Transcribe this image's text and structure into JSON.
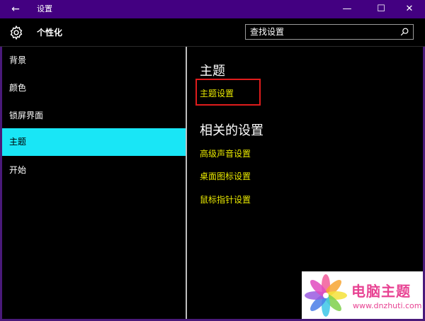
{
  "window": {
    "title": "设置",
    "back_glyph": "←",
    "minimize_glyph": "—",
    "maximize_glyph": "☐",
    "close_glyph": "✕"
  },
  "header": {
    "app_title": "个性化",
    "search_placeholder": "查找设置"
  },
  "sidebar": {
    "items": [
      {
        "label": "背景"
      },
      {
        "label": "颜色"
      },
      {
        "label": "锁屏界面"
      },
      {
        "label": "主题",
        "selected": true
      },
      {
        "label": "开始"
      }
    ]
  },
  "main": {
    "theme_heading": "主题",
    "theme_settings_link": "主题设置",
    "related_heading": "相关的设置",
    "related_links": [
      {
        "label": "高级声音设置"
      },
      {
        "label": "桌面图标设置"
      },
      {
        "label": "鼠标指针设置"
      }
    ]
  },
  "watermark": {
    "title": "电脑主题",
    "url": "www.dnzhuti.com"
  },
  "colors": {
    "titlebar": "#430081",
    "accent_selected": "#19e6f6",
    "link": "#e8e800",
    "highlight_box": "#e01c1c"
  }
}
